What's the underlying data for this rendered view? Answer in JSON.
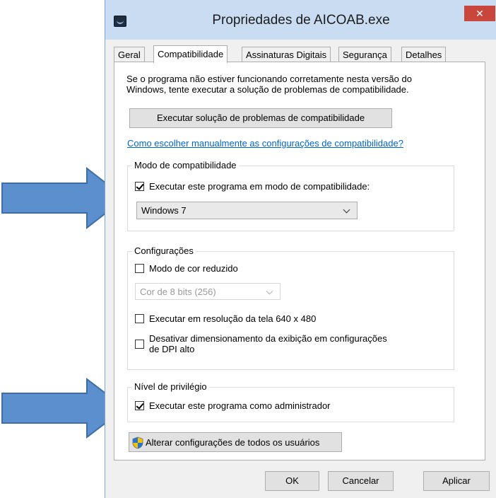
{
  "window": {
    "title": "Propriedades de AICOAB.exe",
    "close_glyph": "✕"
  },
  "tabs": [
    {
      "label": "Geral",
      "active": false
    },
    {
      "label": "Compatibilidade",
      "active": true
    },
    {
      "label": "Assinaturas Digitais",
      "active": false
    },
    {
      "label": "Segurança",
      "active": false
    },
    {
      "label": "Detalhes",
      "active": false
    }
  ],
  "intro": {
    "line1": "Se o programa não estiver funcionando corretamente nesta versão do",
    "line2": "Windows, tente executar a solução de problemas de compatibilidade."
  },
  "troubleshoot_button": "Executar solução de problemas de compatibilidade",
  "manual_link": "Como escolher manualmente as configurações de compatibilidade?",
  "compat_mode": {
    "legend": "Modo de compatibilidade",
    "checkbox_label": "Executar este programa em modo de compatibilidade:",
    "checked": true,
    "selected_os": "Windows 7"
  },
  "settings": {
    "legend": "Configurações",
    "reduced_color_label": "Modo de cor reduzido",
    "reduced_color_checked": false,
    "color_depth": "Cor de 8 bits (256)",
    "resolution_label": "Executar em resolução da tela 640 x 480",
    "resolution_checked": false,
    "dpi_label_line1": "Desativar dimensionamento da exibição em configurações",
    "dpi_label_line2": "de DPI alto",
    "dpi_checked": false
  },
  "privilege": {
    "legend": "Nível de privilégio",
    "admin_label": "Executar este programa como administrador",
    "admin_checked": true
  },
  "all_users_button": "Alterar configurações de todos os usuários",
  "footer": {
    "ok": "OK",
    "cancel": "Cancelar",
    "apply": "Aplicar"
  },
  "colors": {
    "titlebar": "#c9dcf2",
    "close_button": "#c9463d",
    "arrow_fill": "#5b8fce",
    "arrow_stroke": "#3e6ea8",
    "link": "#0066cc"
  },
  "icons": {
    "app": "app-icon",
    "uac": "uac-shield-icon",
    "annotation": "blue-right-arrow"
  }
}
